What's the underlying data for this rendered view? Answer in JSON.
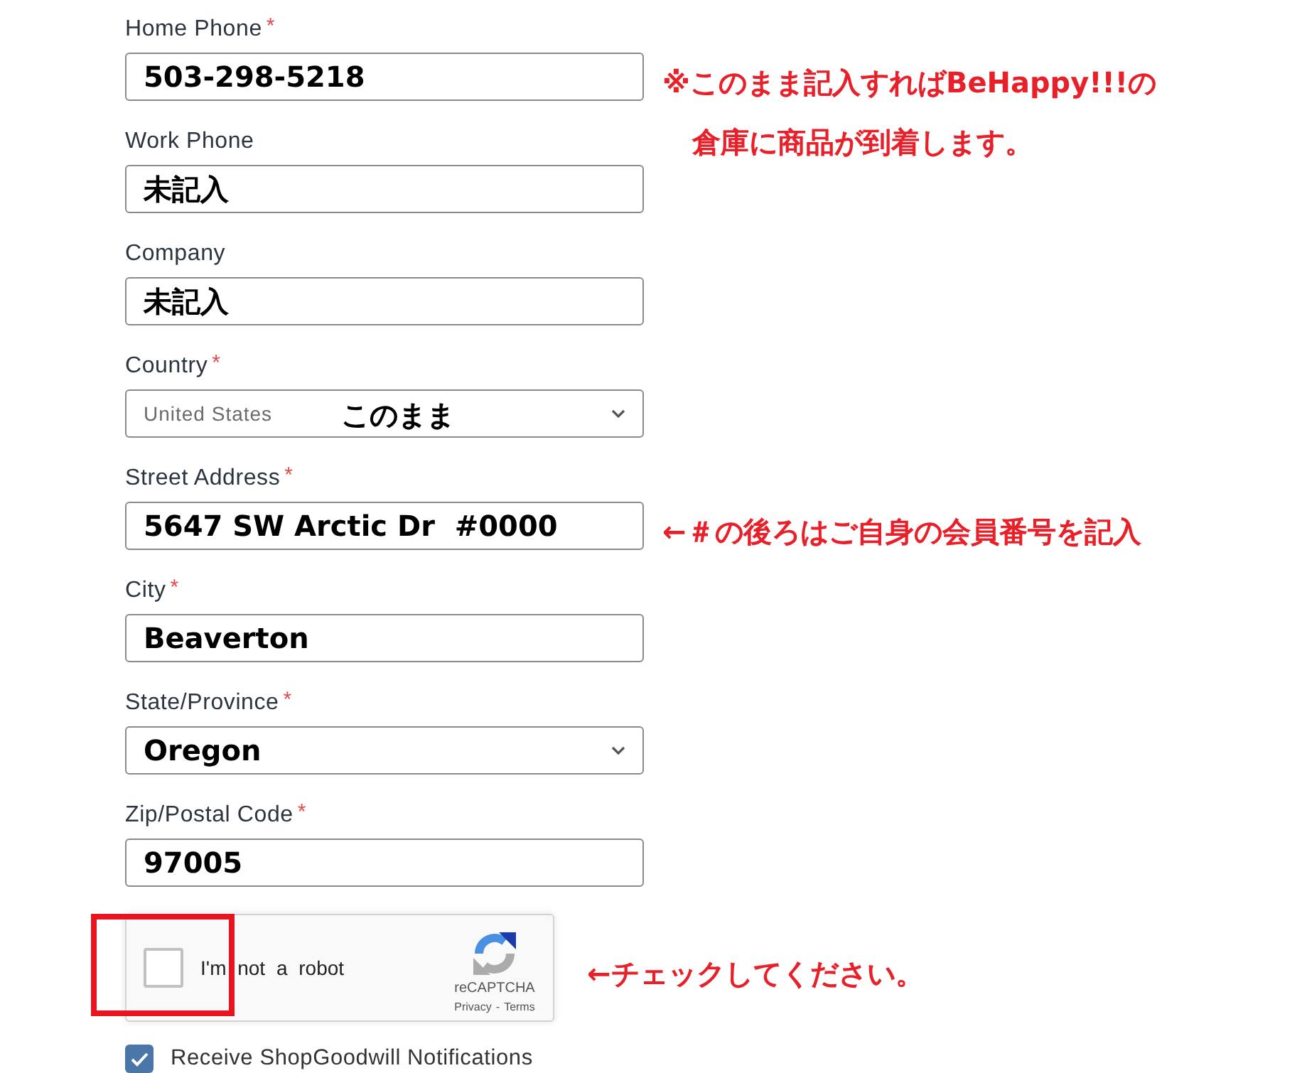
{
  "fields": [
    {
      "kind": "input",
      "label": "Home Phone",
      "mark": "*",
      "value": "503-298-5218",
      "bold": true,
      "note": {
        "lines": [
          "※このまま記入すればBeHappy!!!の",
          "倉庫に商品が到着します。"
        ]
      }
    },
    {
      "kind": "input",
      "label": "Work Phone",
      "value": "未記入",
      "bold": true
    },
    {
      "kind": "input",
      "label": "Company",
      "value": "未記入",
      "bold": true
    },
    {
      "kind": "select",
      "label": "Country",
      "mark": "*",
      "value": "United States",
      "bold": false,
      "overlay": "このまま"
    },
    {
      "kind": "input",
      "label": "Street Address",
      "mark": "*",
      "value": "5647 SW Arctic Dr  #0000",
      "bold": true,
      "note": {
        "lines": [
          "←＃の後ろはご自身の会員番号を記入"
        ]
      }
    },
    {
      "kind": "input",
      "label": "City",
      "mark": "*",
      "value": "Beaverton",
      "bold": true
    },
    {
      "kind": "select",
      "label": "State/Province",
      "mark": "*",
      "value": "Oregon",
      "bold": true
    },
    {
      "kind": "input",
      "label": "Zip/Postal Code",
      "mark": "*",
      "value": "97005",
      "bold": true
    }
  ],
  "captcha": {
    "checked": false,
    "label": "I'm not a robot",
    "brand": "reCAPTCHA",
    "privacy_link": "Privacy",
    "separator": "-",
    "terms_link": "Terms",
    "highlighted": true,
    "note": "←チェックしてください。"
  },
  "notifications": {
    "checked": true,
    "label": "Receive ShopGoodwill Notifications"
  }
}
